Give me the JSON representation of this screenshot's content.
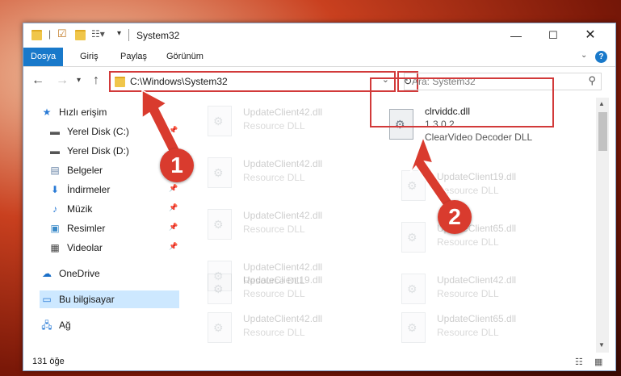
{
  "window": {
    "title": "System32"
  },
  "ribbon": {
    "tabs": [
      "Dosya",
      "Giriş",
      "Paylaş",
      "Görünüm"
    ]
  },
  "address": {
    "path": "C:\\Windows\\System32"
  },
  "search": {
    "placeholder": "Ara: System32"
  },
  "sidebar": {
    "items": [
      {
        "label": "Hızlı erişim",
        "icon": "star-icon"
      },
      {
        "label": "Yerel Disk (C:)",
        "icon": "drive-icon",
        "pinned": true
      },
      {
        "label": "Yerel Disk (D:)",
        "icon": "drive-icon"
      },
      {
        "label": "Belgeler",
        "icon": "documents-icon"
      },
      {
        "label": "İndirmeler",
        "icon": "download-icon",
        "pinned": true
      },
      {
        "label": "Müzik",
        "icon": "music-icon",
        "pinned": true
      },
      {
        "label": "Resimler",
        "icon": "pictures-icon",
        "pinned": true
      },
      {
        "label": "Videolar",
        "icon": "videos-icon",
        "pinned": true
      },
      {
        "label": "OneDrive",
        "icon": "cloud-icon"
      },
      {
        "label": "Bu bilgisayar",
        "icon": "computer-icon",
        "selected": true
      },
      {
        "label": "Ağ",
        "icon": "network-icon"
      }
    ]
  },
  "files": {
    "highlighted": {
      "name": "clrviddc.dll",
      "version": "1.3.0.2",
      "description": "ClearVideo Decoder DLL"
    },
    "left_column": [
      {
        "name": "UpdateClient42.dll",
        "type": "Resource DLL"
      },
      {
        "name": "UpdateClient42.dll",
        "type": "Resource DLL"
      },
      {
        "name": "UpdateClient42.dll",
        "type": "Resource DLL"
      },
      {
        "name": "UpdateClient42.dll",
        "type": "Resource DLL"
      },
      {
        "name": "UpdateClient19.dll",
        "type": "Resource DLL"
      },
      {
        "name": "UpdateClient42.dll",
        "type": "Resource DLL"
      }
    ],
    "right_column": [
      {
        "name": "UpdateClient19.dll",
        "type": "Resource DLL"
      },
      {
        "name": "UpdateClient65.dll",
        "type": "Resource DLL"
      },
      {
        "name": "UpdateClient42.dll",
        "type": "Resource DLL"
      },
      {
        "name": "UpdateClient65.dll",
        "type": "Resource DLL"
      }
    ]
  },
  "status": {
    "count": "131 öğe"
  },
  "annotations": {
    "badge1": "1",
    "badge2": "2"
  },
  "colors": {
    "accent": "#1979ca",
    "highlight": "#d23a3a",
    "badge": "#d93b2e"
  }
}
